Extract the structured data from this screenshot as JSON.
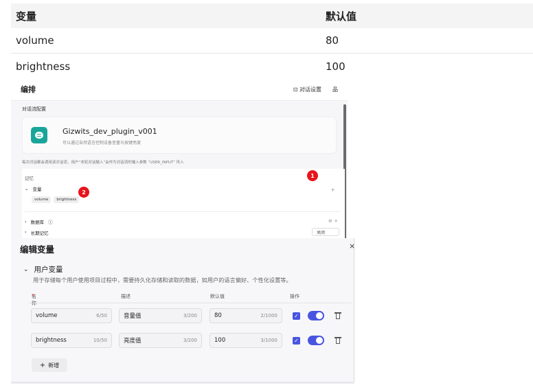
{
  "doc_table": {
    "headers": [
      "变量",
      "默认值"
    ],
    "rows": [
      {
        "name": "volume",
        "default": "80"
      },
      {
        "name": "brightness",
        "default": "100"
      }
    ]
  },
  "arrange": {
    "title": "编排",
    "dialog_settings": "对话设置",
    "more_label": "品",
    "flow_config_label": "对话流配置",
    "plugin": {
      "name": "Gizwits_dev_plugin_v001",
      "description": "可以通过自然语言控制设备音量与按键亮度"
    },
    "flow_note": "每次对话都会调用该对话流，用户“本轮对话输入”会作为对话流的输入参数 “USER_INPUT” 传入",
    "memory_label": "记忆",
    "variables_label": "变量",
    "variable_chips": [
      "volume",
      "brightness"
    ],
    "badge_1": "1",
    "badge_2": "2",
    "database_label": "数据库",
    "ltm_label": "长期记忆",
    "ltm_value": "关闭"
  },
  "dialog": {
    "title": "编辑变量",
    "section_title": "用户变量",
    "section_desc": "用于存储每个用户使用项目过程中，需要持久化存储和读取的数据，如用户的语言偏好、个性化设置等。",
    "col_name": "名称",
    "col_name_required": "*",
    "col_desc": "描述",
    "col_default": "默认值",
    "col_ops": "操作",
    "rows": [
      {
        "name": "volume",
        "name_count": "6/50",
        "desc": "音量值",
        "desc_count": "3/200",
        "default": "80",
        "default_count": "2/1000"
      },
      {
        "name": "brightness",
        "name_count": "10/50",
        "desc": "亮度值",
        "desc_count": "3/200",
        "default": "100",
        "default_count": "3/1000"
      }
    ],
    "add_label": "新增",
    "close_symbol": "×"
  },
  "colors": {
    "accent": "#4955e0",
    "badge": "#e8141b",
    "plugin_icon": "#1aa59a"
  }
}
